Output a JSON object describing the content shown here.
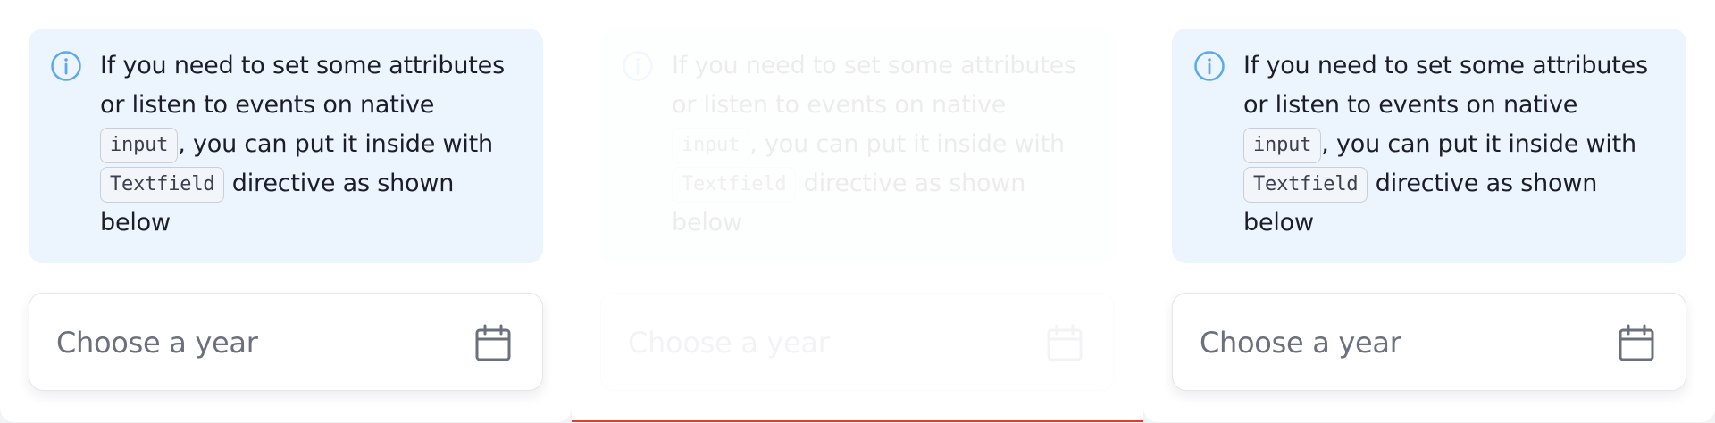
{
  "panels": [
    {
      "alert": {
        "text_1": "If you need to set some attributes or listen to events on native",
        "code_1": "input",
        "text_2": ", you can put it inside with",
        "code_2": "Textfield",
        "text_3": "directive as shown below",
        "icon": "info-icon"
      },
      "datefield": {
        "placeholder": "Choose a year",
        "icon": "calendar-icon"
      }
    },
    {
      "alert": {
        "text_1": "If you need to set some attributes or listen to events on native",
        "code_1": "input",
        "text_2": ", you can put it inside with",
        "code_2": "Textfield",
        "text_3": "directive as shown below",
        "icon": "info-icon"
      },
      "datefield": {
        "placeholder": "Choose a year",
        "icon": "calendar-icon"
      }
    },
    {
      "alert": {
        "text_1": "If you need to set some attributes or listen to events on native",
        "code_1": "input",
        "text_2": ", you can put it inside with",
        "code_2": "Textfield",
        "text_3": "directive as shown below",
        "icon": "info-icon"
      },
      "datefield": {
        "placeholder": "Choose a year",
        "icon": "calendar-icon"
      }
    }
  ],
  "colors": {
    "alert_background": "#ecf4fd",
    "info_icon": "#5aa9f0",
    "text": "#1c1d2a",
    "placeholder": "#6b6f7e",
    "calendar_icon": "#6b6f7e",
    "active_underline": "#e53935"
  }
}
